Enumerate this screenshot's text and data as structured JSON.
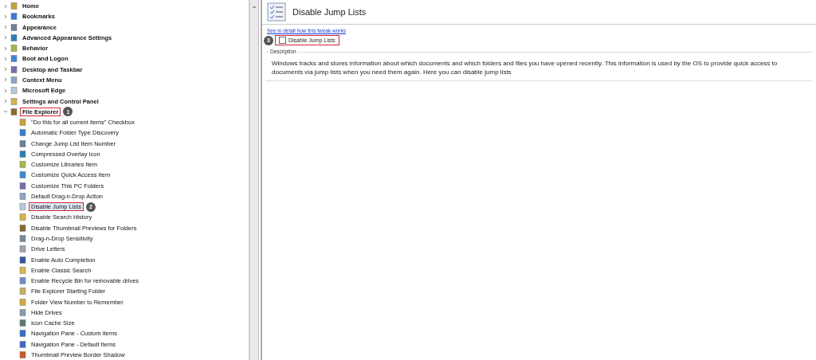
{
  "tree": [
    {
      "label": "Home",
      "expanded": false
    },
    {
      "label": "Bookmarks",
      "expanded": false
    },
    {
      "label": "Appearance",
      "expanded": false
    },
    {
      "label": "Advanced Appearance Settings",
      "expanded": false
    },
    {
      "label": "Behavior",
      "expanded": false
    },
    {
      "label": "Boot and Logon",
      "expanded": false
    },
    {
      "label": "Desktop and Taskbar",
      "expanded": false
    },
    {
      "label": "Context Menu",
      "expanded": false
    },
    {
      "label": "Microsoft Edge",
      "expanded": false
    },
    {
      "label": "Settings and Control Panel",
      "expanded": false
    },
    {
      "label": "File Explorer",
      "expanded": true,
      "highlighted": true,
      "badge": "1",
      "children": [
        {
          "label": "\"Do this for all current items\" Checkbox",
          "selected": false
        },
        {
          "label": "Automatic Folder Type Discovery",
          "selected": false
        },
        {
          "label": "Change Jump List Item Number",
          "selected": false
        },
        {
          "label": "Compressed Overlay Icon",
          "selected": false
        },
        {
          "label": "Customize Libraries Item",
          "selected": false
        },
        {
          "label": "Customize Quick Access Item",
          "selected": false
        },
        {
          "label": "Customize This PC Folders",
          "selected": false
        },
        {
          "label": "Default Drag-n-Drop Action",
          "selected": false
        },
        {
          "label": "Disable Jump Lists",
          "selected": true,
          "highlighted": true,
          "badge": "2"
        },
        {
          "label": "Disable Search History",
          "selected": false
        },
        {
          "label": "Disable Thumbnail Previews for Folders",
          "selected": false
        },
        {
          "label": "Drag-n-Drop Sensitivity",
          "selected": false
        },
        {
          "label": "Drive Letters",
          "selected": false
        },
        {
          "label": "Enable Auto Completion",
          "selected": false
        },
        {
          "label": "Enable Classic Search",
          "selected": false
        },
        {
          "label": "Enable Recycle Bin for removable drives",
          "selected": false
        },
        {
          "label": "File Explorer Starting Folder",
          "selected": false
        },
        {
          "label": "Folder View Number to Remember",
          "selected": false
        },
        {
          "label": "Hide Drives",
          "selected": false
        },
        {
          "label": "Icon Cache Size",
          "selected": false
        },
        {
          "label": "Navigation Pane - Custom Items",
          "selected": false
        },
        {
          "label": "Navigation Pane - Default Items",
          "selected": false
        },
        {
          "label": "Thumbnail Preview Border Shadow",
          "selected": false
        }
      ]
    }
  ],
  "detail": {
    "title": "Disable Jump Lists",
    "link": "See in detail how this tweak works",
    "option": {
      "label": "Disable Jump Lists",
      "checked": false,
      "highlighted": true,
      "badge": "3"
    },
    "description_label": "Description",
    "description": "Windows tracks and stores information about which documents and which folders and files you have opened recently. This information is used by the OS to provide quick access to documents via jump lists when you need them again. Here you can disable jump lists"
  }
}
